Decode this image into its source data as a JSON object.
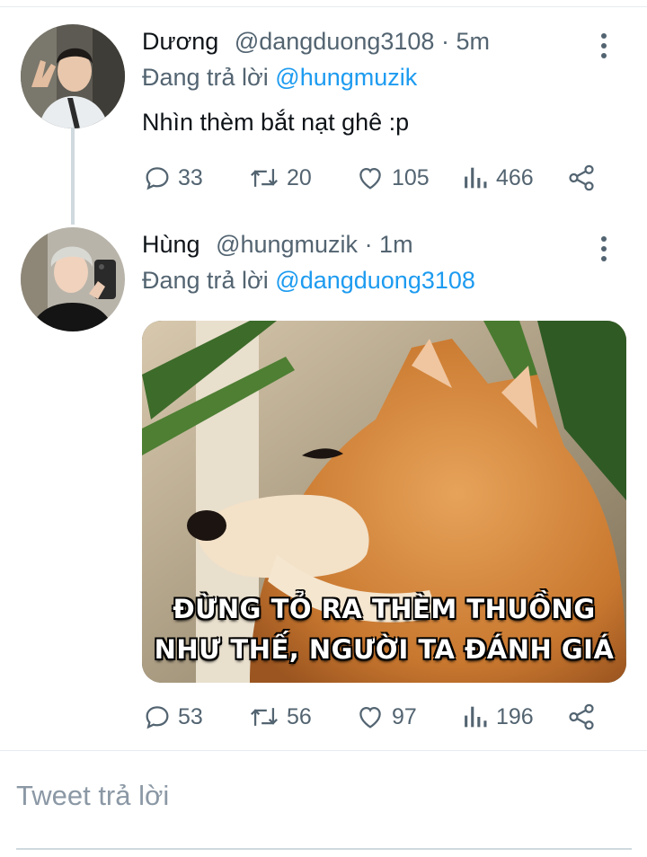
{
  "tweets": [
    {
      "name": "Dương",
      "handle": "@dangduong3108",
      "time": "· 5m",
      "reply_prefix": "Đang trả lời",
      "reply_mention": "@hungmuzik",
      "text": "Nhìn thèm bắt nạt ghê :p",
      "stats": {
        "replies": "33",
        "retweets": "20",
        "likes": "105",
        "views": "466"
      }
    },
    {
      "name": "Hùng",
      "handle": "@hungmuzik",
      "time": "· 1m",
      "reply_prefix": "Đang trả lời",
      "reply_mention": "@dangduong3108",
      "media_caption_line1": "ĐỪNG TỎ RA THÈM THUỒNG",
      "media_caption_line2": "NHƯ THẾ, NGƯỜI TA ĐÁNH GIÁ",
      "stats": {
        "replies": "53",
        "retweets": "56",
        "likes": "97",
        "views": "196"
      }
    }
  ],
  "composer": {
    "placeholder": "Tweet trả lời"
  },
  "icons": [
    "reply-icon",
    "retweet-icon",
    "like-icon",
    "views-icon",
    "share-icon",
    "more-icon"
  ],
  "colors": {
    "mention": "#1d9bf0",
    "secondary_text": "#536471"
  }
}
